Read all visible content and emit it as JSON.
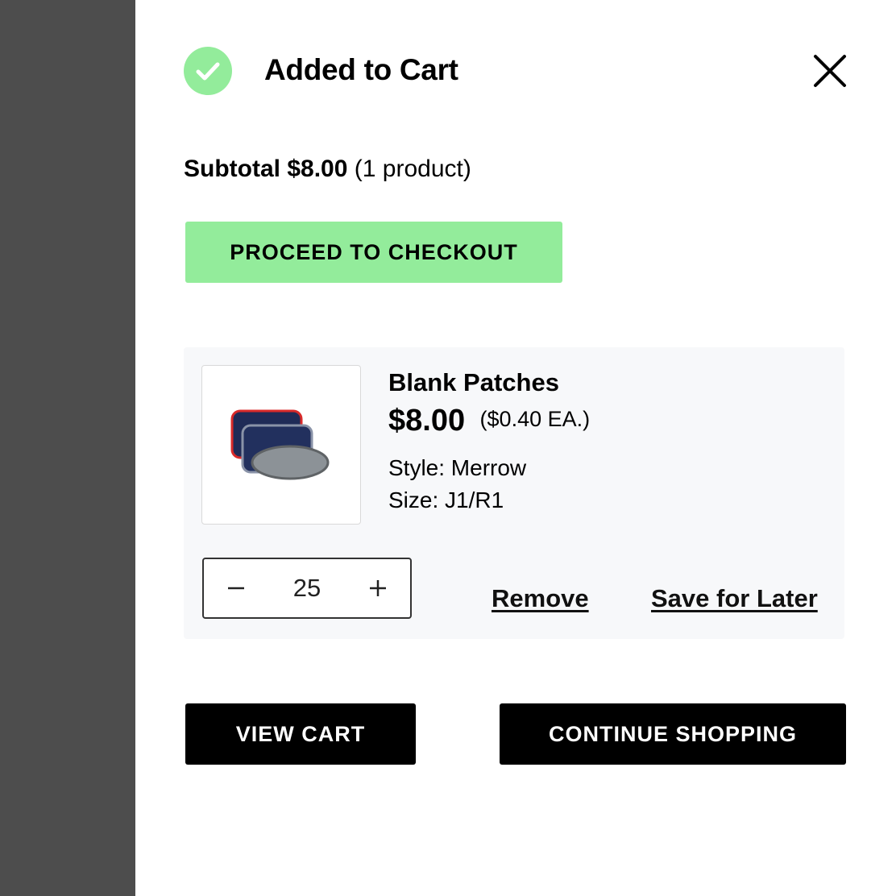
{
  "modal": {
    "title": "Added to Cart",
    "subtotal_label": "Subtotal",
    "subtotal_amount": "$8.00",
    "subtotal_count": "(1 product)",
    "checkout_label": "PROCEED TO CHECKOUT",
    "view_cart_label": "VIEW CART",
    "continue_label": "CONTINUE SHOPPING"
  },
  "item": {
    "name": "Blank Patches",
    "price": "$8.00",
    "each_price": "($0.40 EA.)",
    "style": "Style: Merrow",
    "size": "Size: J1/R1",
    "quantity": "25",
    "remove_label": "Remove",
    "save_label": "Save for Later"
  },
  "icons": {
    "success": "check-circle-icon",
    "close": "close-icon",
    "decrement": "minus-icon",
    "increment": "plus-icon"
  },
  "colors": {
    "accent_green": "#93ec9b",
    "overlay": "#4d4d4d",
    "card_bg": "#f7f8fa",
    "button_dark": "#000000"
  }
}
